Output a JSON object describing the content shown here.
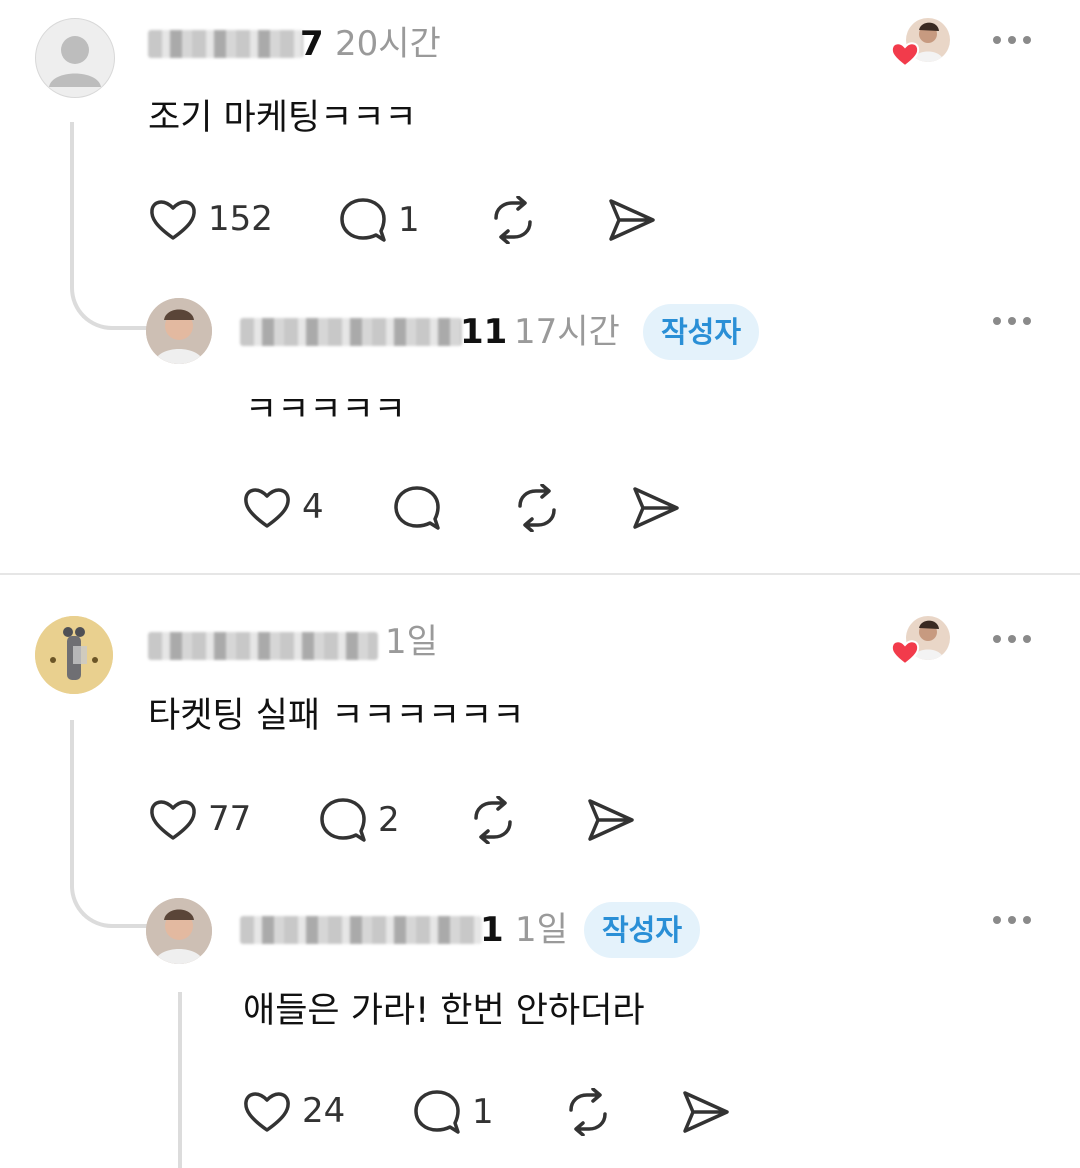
{
  "comments": [
    {
      "name_suffix": "7",
      "time": "20시간",
      "text": "조기 마케팅ㅋㅋㅋ",
      "likes": "152",
      "replies": "1",
      "reply": {
        "name_suffix": "11",
        "time": "17시간",
        "badge": "작성자",
        "text": "ㅋㅋㅋㅋㅋ",
        "likes": "4"
      }
    },
    {
      "name_suffix": "",
      "time": "1일",
      "text": "타켓팅 실패 ㅋㅋㅋㅋㅋㅋ",
      "likes": "77",
      "replies": "2",
      "reply": {
        "name_suffix": "1",
        "time": "1일",
        "badge": "작성자",
        "text": "애들은 가라! 한번 안하더라",
        "likes": "24",
        "replies": "1"
      }
    }
  ],
  "icons": {
    "like": "heart-icon",
    "reply": "comment-icon",
    "repost": "repost-icon",
    "share": "share-icon",
    "more": "more-icon",
    "liked_by_author": "heart-badge-icon"
  },
  "colors": {
    "badge_bg": "#e4f2fb",
    "badge_text": "#2a8fd6",
    "heart_red": "#f23b4b",
    "secondary_text": "#9a9a9a"
  }
}
